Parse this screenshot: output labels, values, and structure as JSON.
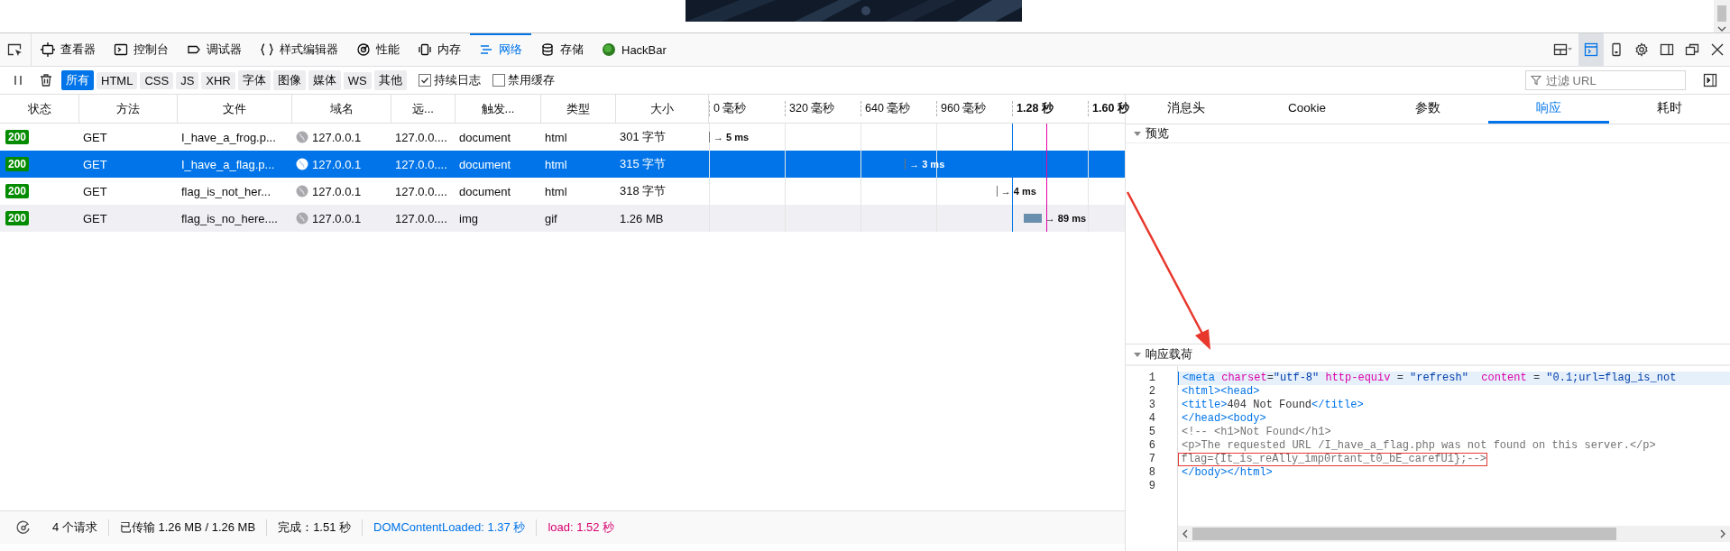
{
  "toolbar": {
    "tabs": [
      {
        "label": "查看器",
        "selected": false
      },
      {
        "label": "控制台",
        "selected": false
      },
      {
        "label": "调试器",
        "selected": false
      },
      {
        "label": "样式编辑器",
        "selected": false
      },
      {
        "label": "性能",
        "selected": false
      },
      {
        "label": "内存",
        "selected": false
      },
      {
        "label": "网络",
        "selected": true
      },
      {
        "label": "存储",
        "selected": false
      },
      {
        "label": "HackBar",
        "selected": false
      }
    ],
    "buttons": [
      {
        "kind": "layout",
        "selected": false
      },
      {
        "kind": "split-console",
        "selected": true
      },
      {
        "kind": "phone",
        "selected": false
      },
      {
        "kind": "settings",
        "selected": false
      },
      {
        "kind": "sidebar",
        "selected": false
      },
      {
        "kind": "popout",
        "selected": false
      },
      {
        "kind": "close",
        "selected": false
      }
    ]
  },
  "filter_bar": {
    "types": [
      {
        "label": "所有",
        "selected": true
      },
      {
        "label": "HTML",
        "selected": false
      },
      {
        "label": "CSS",
        "selected": false
      },
      {
        "label": "JS",
        "selected": false
      },
      {
        "label": "XHR",
        "selected": false
      },
      {
        "label": "字体",
        "selected": false
      },
      {
        "label": "图像",
        "selected": false
      },
      {
        "label": "媒体",
        "selected": false
      },
      {
        "label": "WS",
        "selected": false
      },
      {
        "label": "其他",
        "selected": false
      }
    ],
    "options": [
      {
        "label": "持续日志",
        "checked": true
      },
      {
        "label": "禁用缓存",
        "checked": false
      }
    ],
    "search": {
      "placeholder": "过滤 URL"
    }
  },
  "table": {
    "columns": [
      "状态",
      "方法",
      "文件",
      "域名",
      "远...",
      "触发...",
      "类型",
      "大小"
    ],
    "timeline_ticks": [
      {
        "label": "0 毫秒",
        "emphasis": false
      },
      {
        "label": "320 毫秒",
        "emphasis": false
      },
      {
        "label": "640 毫秒",
        "emphasis": false
      },
      {
        "label": "960 毫秒",
        "emphasis": false
      },
      {
        "label": "1.28 秒",
        "emphasis": true
      },
      {
        "label": "1.60 秒",
        "emphasis": true
      }
    ],
    "markers": [
      {
        "kind": "dom"
      },
      {
        "kind": "load"
      }
    ],
    "rows": [
      {
        "status": "200",
        "method": "GET",
        "file": "I_have_a_frog.p...",
        "domain": "127.0.0.1",
        "remote": "127.0.0....",
        "cause": "document",
        "type": "html",
        "size": "301 字节",
        "timing": "→ 5 ms",
        "level": 0.0,
        "kind": "tick",
        "selected": false,
        "hovered": false
      },
      {
        "status": "200",
        "method": "GET",
        "file": "I_have_a_flag.p...",
        "domain": "127.0.0.1",
        "remote": "127.0.0....",
        "cause": "document",
        "type": "html",
        "size": "315 字节",
        "timing": "→ 3 ms",
        "level": 0.47,
        "kind": "tick",
        "selected": true,
        "hovered": false
      },
      {
        "status": "200",
        "method": "GET",
        "file": "flag_is_not_her...",
        "domain": "127.0.0.1",
        "remote": "127.0.0....",
        "cause": "document",
        "type": "html",
        "size": "318 字节",
        "timing": "→ 4 ms",
        "level": 0.69,
        "kind": "tick",
        "selected": false,
        "hovered": false
      },
      {
        "status": "200",
        "method": "GET",
        "file": "flag_is_no_here....",
        "domain": "127.0.0.1",
        "remote": "127.0.0....",
        "cause": "img",
        "type": "gif",
        "size": "1.26 MB",
        "timing": "→ 89 ms",
        "level": 0.755,
        "kind": "bar",
        "selected": false,
        "hovered": true
      }
    ]
  },
  "status_bar": [
    {
      "text": "4 个请求",
      "kind": "plain"
    },
    {
      "text": "已传输 1.26 MB / 1.26 MB",
      "kind": "plain"
    },
    {
      "text": "完成：1.51 秒",
      "kind": "plain"
    },
    {
      "text": "DOMContentLoaded: 1.37 秒",
      "kind": "dom"
    },
    {
      "text": "load: 1.52 秒",
      "kind": "load"
    }
  ],
  "details": {
    "tabs": [
      {
        "label": "消息头",
        "selected": false
      },
      {
        "label": "Cookie",
        "selected": false
      },
      {
        "label": "参数",
        "selected": false
      },
      {
        "label": "响应",
        "selected": true
      },
      {
        "label": "耗时",
        "selected": false
      }
    ],
    "preview": {
      "title": "预览",
      "expanded": true
    },
    "payload": {
      "title": "响应载荷",
      "expanded": true,
      "lines": [
        {
          "number": "1",
          "current": true,
          "boxed": false,
          "tokens": [
            {
              "kind": "tag",
              "text": "<meta"
            },
            {
              "kind": "attr",
              "text": " charset"
            },
            {
              "kind": "text",
              "text": "="
            },
            {
              "kind": "value",
              "text": "\"utf-8\""
            },
            {
              "kind": "attr",
              "text": " http-equiv"
            },
            {
              "kind": "text",
              "text": " = "
            },
            {
              "kind": "value",
              "text": "\"refresh\""
            },
            {
              "kind": "attr",
              "text": "  content"
            },
            {
              "kind": "text",
              "text": " = "
            },
            {
              "kind": "value",
              "text": "\"0.1;url=flag_is_not"
            }
          ]
        },
        {
          "number": "2",
          "current": false,
          "boxed": false,
          "tokens": [
            {
              "kind": "tag",
              "text": "<html><head>"
            }
          ]
        },
        {
          "number": "3",
          "current": false,
          "boxed": false,
          "tokens": [
            {
              "kind": "tag",
              "text": "<title>"
            },
            {
              "kind": "text",
              "text": "404 Not Found"
            },
            {
              "kind": "tag",
              "text": "</title>"
            }
          ]
        },
        {
          "number": "4",
          "current": false,
          "boxed": false,
          "tokens": [
            {
              "kind": "tag",
              "text": "</head><body>"
            }
          ]
        },
        {
          "number": "5",
          "current": false,
          "boxed": false,
          "tokens": [
            {
              "kind": "comment",
              "text": "<!-- <h1>Not Found</h1>"
            }
          ]
        },
        {
          "number": "6",
          "current": false,
          "boxed": false,
          "tokens": [
            {
              "kind": "comment",
              "text": "<p>The requested URL /I_have_a_flag.php was not found on this server.</p>"
            }
          ]
        },
        {
          "number": "7",
          "current": false,
          "boxed": true,
          "tokens": [
            {
              "kind": "comment",
              "text": "flag={It_is_reAlly_imp0rtant_t0_bE_carefU1};-->"
            }
          ]
        },
        {
          "number": "8",
          "current": false,
          "boxed": false,
          "tokens": [
            {
              "kind": "tag",
              "text": "</body></html>"
            }
          ]
        },
        {
          "number": "9"
        }
      ]
    }
  }
}
